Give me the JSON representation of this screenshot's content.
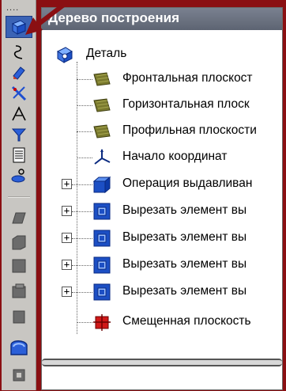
{
  "panel": {
    "title": "Дерево построения"
  },
  "tree": {
    "root_label": "Деталь",
    "items": [
      {
        "label": "Фронтальная плоскост",
        "icon": "plane-icon",
        "expandable": false
      },
      {
        "label": "Горизонтальная плоск",
        "icon": "plane-icon",
        "expandable": false
      },
      {
        "label": "Профильная плоскости",
        "icon": "plane-icon",
        "expandable": false
      },
      {
        "label": "Начало координат",
        "icon": "axes-icon",
        "expandable": false
      },
      {
        "label": "Операция выдавливан",
        "icon": "extrude-icon",
        "expandable": true
      },
      {
        "label": "Вырезать элемент вы",
        "icon": "cut-icon",
        "expandable": true
      },
      {
        "label": "Вырезать элемент вы",
        "icon": "cut-icon",
        "expandable": true
      },
      {
        "label": "Вырезать элемент вы",
        "icon": "cut-icon",
        "expandable": true
      },
      {
        "label": "Вырезать элемент вы",
        "icon": "cut-icon",
        "expandable": true
      },
      {
        "label": "Смещенная плоскость",
        "icon": "offset-plane-icon",
        "expandable": false
      }
    ],
    "expander_symbol": "+"
  },
  "toolbar": {
    "grip": "....",
    "tools": [
      "part-icon",
      "sketch-curve-icon",
      "edit-icon",
      "measure-icon",
      "spec-icon",
      "filter-icon",
      "report-icon",
      "attribute-icon"
    ]
  },
  "colors": {
    "background": "#8a0f12",
    "titlebar": "#6b7280",
    "accent_blue": "#1e4fd0",
    "plane": "#7a7a2e"
  }
}
